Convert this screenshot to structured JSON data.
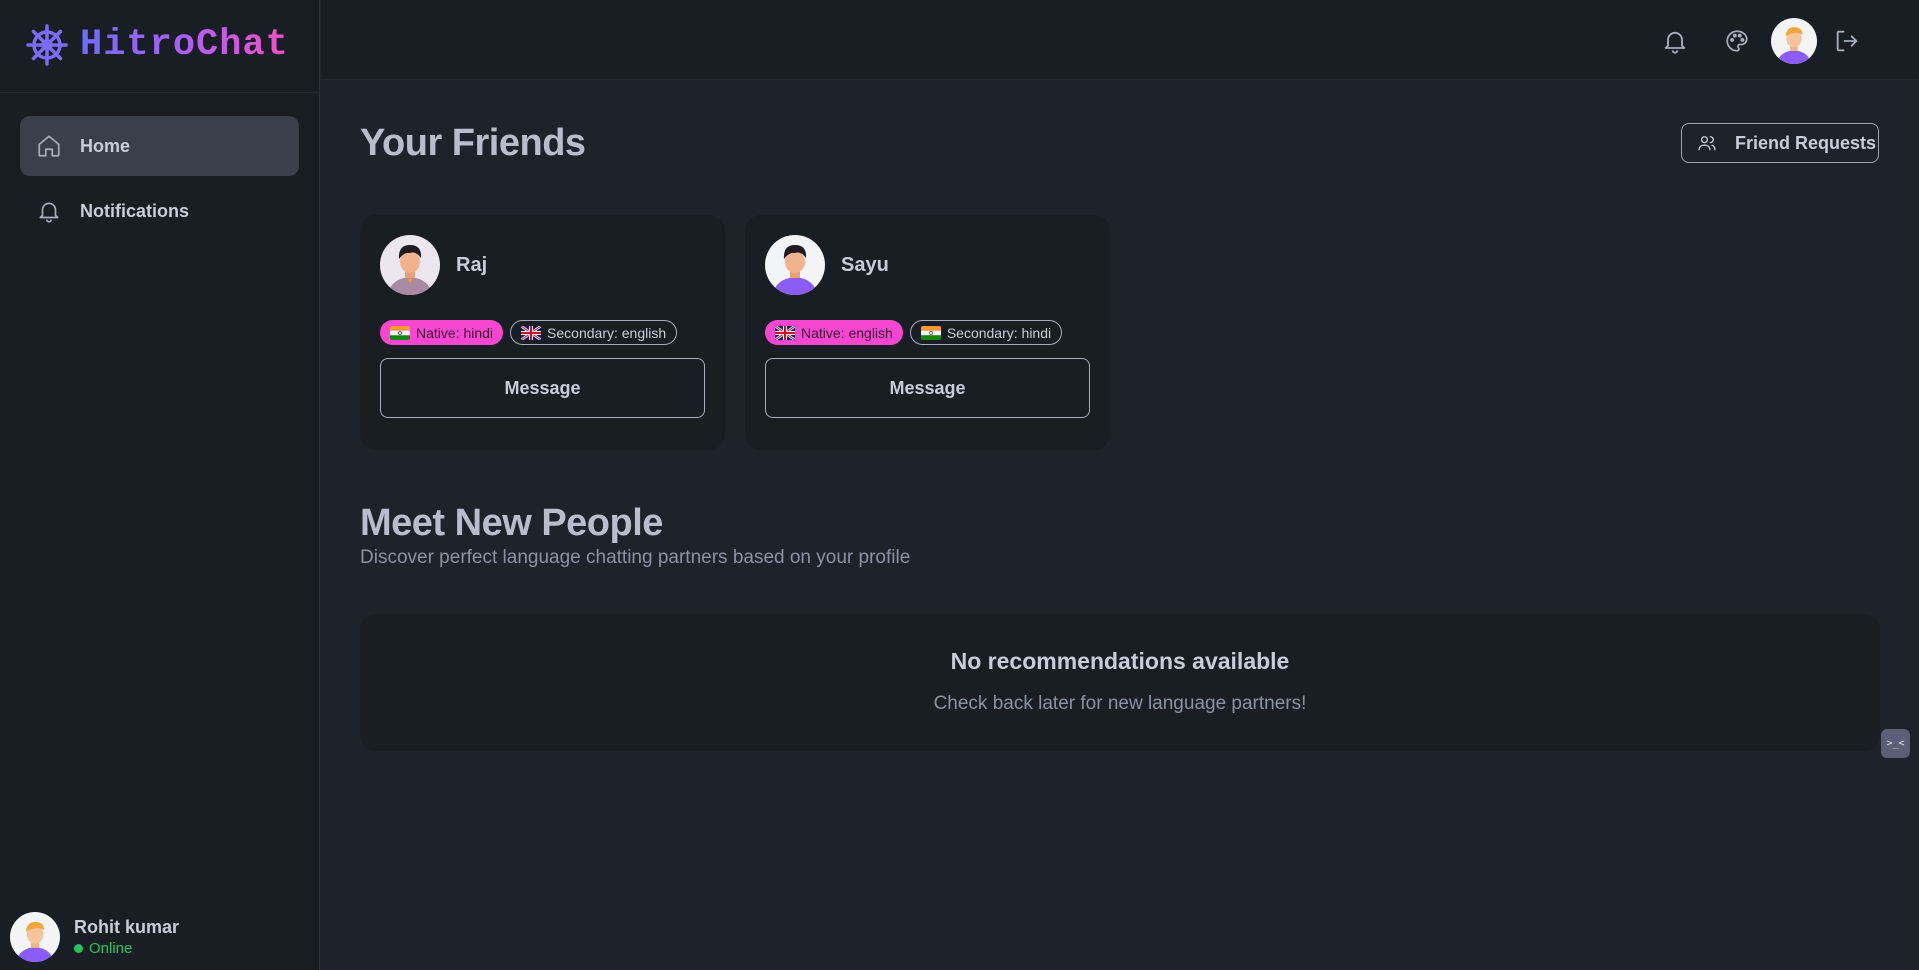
{
  "app": {
    "name": "HitroChat",
    "logo_icon": "ship-wheel-icon"
  },
  "sidebar": {
    "items": [
      {
        "label": "Home",
        "icon": "home-icon",
        "active": true
      },
      {
        "label": "Notifications",
        "icon": "bell-icon",
        "active": false
      }
    ],
    "user": {
      "name": "Rohit kumar",
      "status": "Online"
    }
  },
  "topbar": {
    "icons": [
      "bell-icon",
      "palette-icon",
      "avatar",
      "logout-icon"
    ]
  },
  "friends": {
    "title": "Your Friends",
    "requests_label": "Friend Requests",
    "list": [
      {
        "name": "Raj",
        "native": "Native: hindi",
        "native_flag": "india",
        "secondary": "Secondary: english",
        "secondary_flag": "uk",
        "button": "Message"
      },
      {
        "name": "Sayu",
        "native": "Native: english",
        "native_flag": "uk",
        "secondary": "Secondary: hindi",
        "secondary_flag": "india",
        "button": "Message"
      }
    ]
  },
  "meet": {
    "title": "Meet New People",
    "subtitle": "Discover perfect language chatting partners based on your profile",
    "empty_title": "No recommendations available",
    "empty_subtitle": "Check back later for new language partners!"
  },
  "widget": {
    "label": ">_<"
  },
  "colors": {
    "accent_pink": "#f747d0",
    "online": "#22c55e",
    "logo_start": "#6d6dff",
    "logo_end": "#f050c8"
  }
}
